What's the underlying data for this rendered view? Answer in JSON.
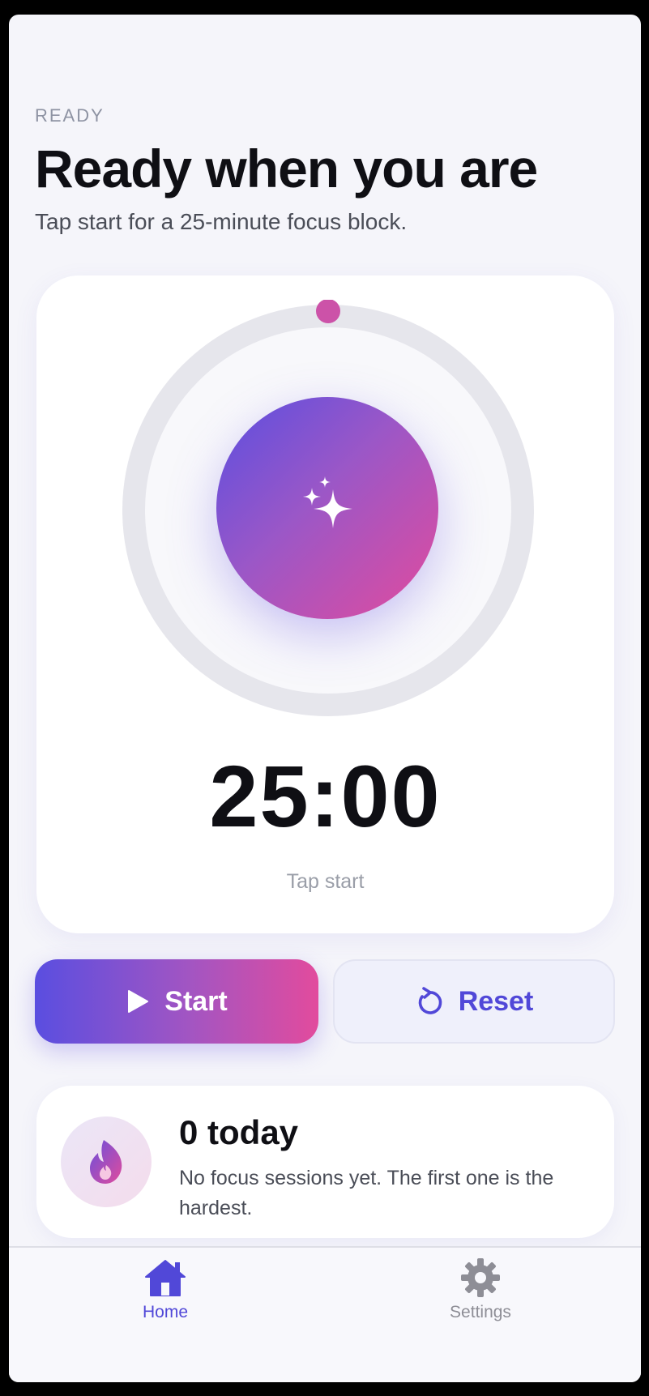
{
  "header": {
    "eyebrow": "READY",
    "title": "Ready when you are",
    "subtitle": "Tap start for a 25-minute focus block."
  },
  "timer": {
    "time": "25:00",
    "hint": "Tap start",
    "progress": 0,
    "icon": "sparkles-icon"
  },
  "actions": {
    "start_label": "Start",
    "reset_label": "Reset"
  },
  "stats": {
    "count": "0 today",
    "description": "No focus sessions yet. The first one is the hardest.",
    "icon": "flame-icon"
  },
  "tabs": [
    {
      "label": "Home",
      "icon": "house-icon",
      "active": true
    },
    {
      "label": "Settings",
      "icon": "gear-icon",
      "active": false
    }
  ],
  "colors": {
    "accent": "#5148d8",
    "gradient_start": "#5a4ee0",
    "gradient_end": "#e24b9d",
    "ring_track": "#e6e6ec",
    "ring_knob": "#cc52a8"
  }
}
